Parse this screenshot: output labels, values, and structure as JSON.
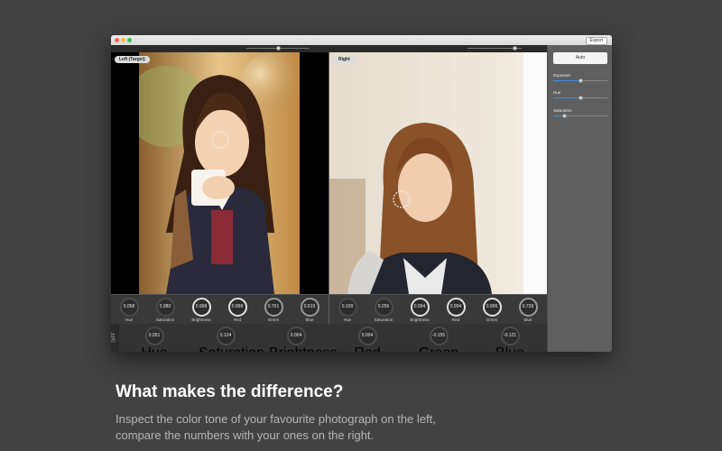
{
  "toolbar": {
    "export_label": "Export"
  },
  "top_sliders": {
    "left_value": 0.5,
    "right_value": 0.88
  },
  "left_pane": {
    "label": "Left (Target)"
  },
  "right_pane": {
    "label": "Right"
  },
  "left_stats": [
    {
      "value": "0.058",
      "label": "Hue"
    },
    {
      "value": "0.380",
      "label": "Saturation"
    },
    {
      "value": "0.998",
      "label": "Brightness"
    },
    {
      "value": "0.998",
      "label": "Red"
    },
    {
      "value": "0.751",
      "label": "Green"
    },
    {
      "value": "0.619",
      "label": "Blue"
    }
  ],
  "right_stats": [
    {
      "value": "0.109",
      "label": "Hue"
    },
    {
      "value": "0.256",
      "label": "Saturation"
    },
    {
      "value": "0.994",
      "label": "Brightness"
    },
    {
      "value": "0.994",
      "label": "Red"
    },
    {
      "value": "0.906",
      "label": "Green"
    },
    {
      "value": "0.739",
      "label": "Blue"
    }
  ],
  "diff": {
    "tag": "DIFF",
    "stats": [
      {
        "value": "0.051",
        "label": "Hue"
      },
      {
        "value": "0.124",
        "label": "Saturation"
      },
      {
        "value": "0.004",
        "label": "Brightness"
      },
      {
        "value": "0.004",
        "label": "Red"
      },
      {
        "value": "-0.155",
        "label": "Green"
      },
      {
        "value": "-0.121",
        "label": "Blue"
      }
    ]
  },
  "sidebar": {
    "auto_label": "Auto",
    "sliders": [
      {
        "label": "Exposure",
        "value": 0.5
      },
      {
        "label": "Hue",
        "value": 0.5
      },
      {
        "label": "Saturation",
        "value": 0.2
      }
    ]
  },
  "marketing": {
    "headline": "What makes the difference?",
    "body_line1": "Inspect the color tone of your favourite photograph on the left,",
    "body_line2": "compare the numbers with your ones on the right."
  }
}
